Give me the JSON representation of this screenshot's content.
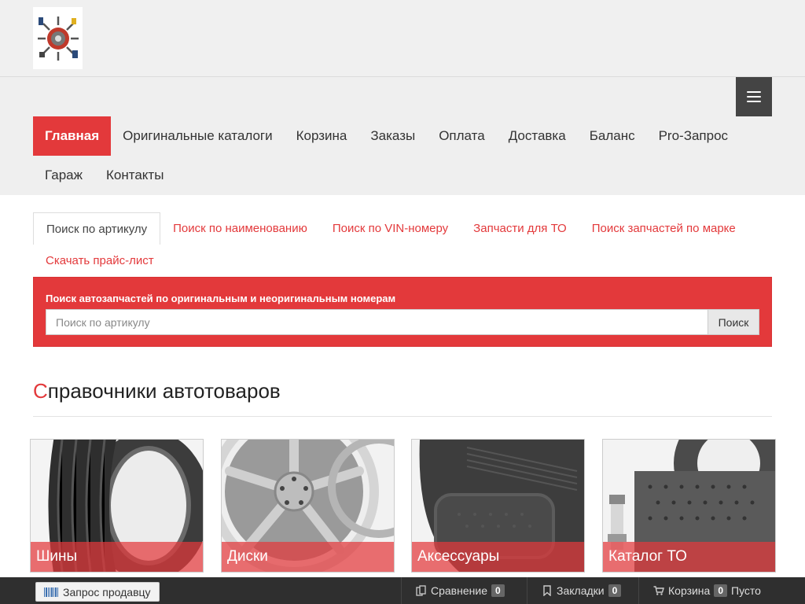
{
  "header": {
    "logo_alt": "logo",
    "menu_icon": "hamburger-menu-icon"
  },
  "nav": {
    "row1": [
      {
        "label": "Главная",
        "active": true
      },
      {
        "label": "Оригинальные каталоги",
        "active": false
      },
      {
        "label": "Корзина",
        "active": false
      },
      {
        "label": "Заказы",
        "active": false
      },
      {
        "label": "Оплата",
        "active": false
      },
      {
        "label": "Доставка",
        "active": false
      },
      {
        "label": "Баланс",
        "active": false
      },
      {
        "label": "Pro-Запрос",
        "active": false
      }
    ],
    "row2": [
      {
        "label": "Гараж",
        "active": false
      },
      {
        "label": "Контакты",
        "active": false
      }
    ]
  },
  "tabs": {
    "row1": [
      {
        "label": "Поиск по артикулу",
        "active": true
      },
      {
        "label": "Поиск по наименованию",
        "active": false
      },
      {
        "label": "Поиск по VIN-номеру",
        "active": false
      },
      {
        "label": "Запчасти для ТО",
        "active": false
      },
      {
        "label": "Поиск запчастей по марке",
        "active": false
      }
    ],
    "row2": [
      {
        "label": "Скачать прайс-лист",
        "active": false
      }
    ]
  },
  "search": {
    "caption": "Поиск автозапчастей по оригинальным и неоригинальным номерам",
    "placeholder": "Поиск по артикулу",
    "value": "",
    "button": "Поиск"
  },
  "section": {
    "title_first": "С",
    "title_rest": "правочники автотоваров"
  },
  "cards": [
    {
      "label": "Шины"
    },
    {
      "label": "Диски"
    },
    {
      "label": "Аксессуары"
    },
    {
      "label": "Каталог ТО"
    }
  ],
  "bottombar": {
    "seller_button": "Запрос продавцу",
    "compare_label": "Сравнение",
    "compare_count": "0",
    "bookmarks_label": "Закладки",
    "bookmarks_count": "0",
    "cart_label": "Корзина",
    "cart_count": "0",
    "cart_status": "Пусто"
  },
  "colors": {
    "accent": "#e3393b",
    "dark": "#2f2f2f"
  }
}
